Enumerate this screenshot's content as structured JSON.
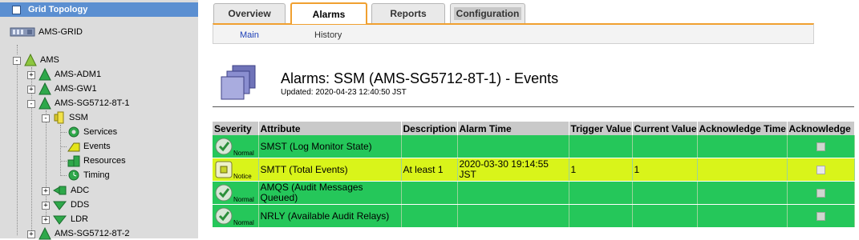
{
  "tree": {
    "header": "Grid Topology",
    "nodes": {
      "grid": "AMS-GRID",
      "site": "AMS",
      "adm": "AMS-ADM1",
      "gw": "AMS-GW1",
      "sg1": "AMS-SG5712-8T-1",
      "ssm": "SSM",
      "services": "Services",
      "events": "Events",
      "resources": "Resources",
      "timing": "Timing",
      "adc": "ADC",
      "dds": "DDS",
      "ldr": "LDR",
      "sg2": "AMS-SG5712-8T-2"
    }
  },
  "tabs": [
    "Overview",
    "Alarms",
    "Reports",
    "Configuration"
  ],
  "subtabs": [
    "Main",
    "History"
  ],
  "page": {
    "title": "Alarms: SSM (AMS-SG5712-8T-1) - Events",
    "updated": "Updated:  2020-04-23 12:40:50 JST"
  },
  "table": {
    "headers": [
      "Severity",
      "Attribute",
      "Description",
      "Alarm Time",
      "Trigger Value",
      "Current Value",
      "Acknowledge Time",
      "Acknowledge"
    ],
    "rows": [
      {
        "severity": "Normal",
        "attribute": "SMST (Log Monitor State)",
        "description": "",
        "alarm_time": "",
        "trigger_value": "",
        "current_value": "",
        "ack_time": ""
      },
      {
        "severity": "Notice",
        "attribute": "SMTT (Total Events)",
        "description": "At least 1",
        "alarm_time": "2020-03-30 19:14:55 JST",
        "trigger_value": "1",
        "current_value": "1",
        "ack_time": ""
      },
      {
        "severity": "Normal",
        "attribute": "AMQS (Audit Messages Queued)",
        "description": "",
        "alarm_time": "",
        "trigger_value": "",
        "current_value": "",
        "ack_time": ""
      },
      {
        "severity": "Normal",
        "attribute": "NRLY (Available Audit Relays)",
        "description": "",
        "alarm_time": "",
        "trigger_value": "",
        "current_value": "",
        "ack_time": ""
      }
    ]
  },
  "colors": {
    "normal": "#25c75a",
    "notice": "#d9f41a",
    "tab_accent": "#f0a030",
    "tree_header": "#5b8fd1"
  }
}
